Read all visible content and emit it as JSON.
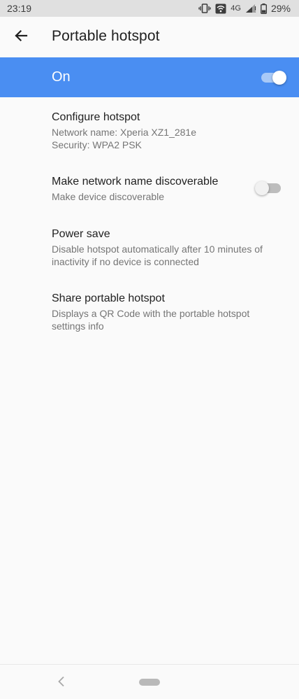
{
  "status_bar": {
    "time": "23:19",
    "network": "4G",
    "battery": "29%"
  },
  "header": {
    "title": "Portable hotspot"
  },
  "master_switch": {
    "label": "On",
    "state": "on",
    "accent_color": "#4a8ef2"
  },
  "items": [
    {
      "title": "Configure hotspot",
      "lines": [
        "Network name: Xperia XZ1_281e",
        "Security: WPA2 PSK"
      ]
    },
    {
      "title": "Make network name discoverable",
      "lines": [
        "Make device discoverable"
      ],
      "switch_state": "off"
    },
    {
      "title": "Power save",
      "lines": [
        "Disable hotspot automatically after 10 minutes of",
        "inactivity if no device is connected"
      ]
    },
    {
      "title": "Share portable hotspot",
      "lines": [
        "Displays a QR Code with the portable hotspot",
        "settings info"
      ]
    }
  ]
}
